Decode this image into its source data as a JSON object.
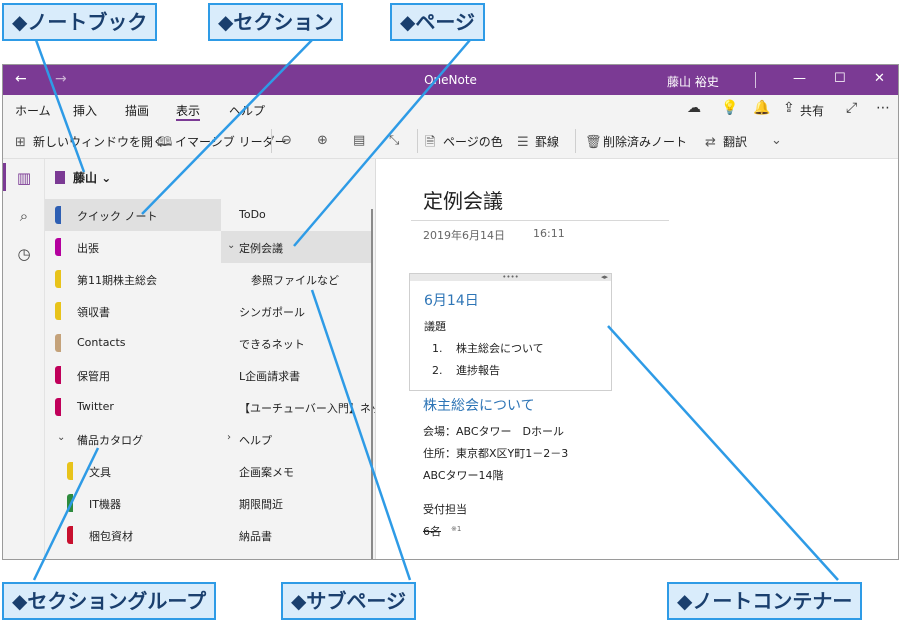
{
  "callouts": {
    "notebook": "◆ノートブック",
    "section": "◆セクション",
    "page": "◆ページ",
    "section_group": "◆セクショングループ",
    "subpage": "◆サブページ",
    "note_container": "◆ノートコンテナー"
  },
  "titlebar": {
    "back": "←",
    "forward": "→",
    "title": "OneNote",
    "user": "藤山 裕史",
    "minimize": "—",
    "maximize": "☐",
    "close": "✕"
  },
  "menu": {
    "tabs": [
      "ホーム",
      "挿入",
      "描画",
      "表示",
      "ヘルプ"
    ],
    "share": "共有",
    "more": "⋯"
  },
  "toolbar": {
    "new_window": "新しいウィンドウを開く",
    "immersive_reader": "イマーシブ リーダー",
    "page_color": "ページの色",
    "rule_lines": "罫線",
    "deleted_notes": "削除済みノート",
    "translate": "翻訳"
  },
  "notebook": {
    "name": "藤山"
  },
  "sections": [
    {
      "label": "クイック ノート",
      "color": "#2e5fb3"
    },
    {
      "label": "出張",
      "color": "#b4009e"
    },
    {
      "label": "第11期株主総会",
      "color": "#e8c31a"
    },
    {
      "label": "領収書",
      "color": "#e8c31a"
    },
    {
      "label": "Contacts",
      "color": "#c4a27a"
    },
    {
      "label": "保管用",
      "color": "#c0005a"
    },
    {
      "label": "Twitter",
      "color": "#c0005a"
    },
    {
      "label": "備品カタログ",
      "color": ""
    },
    {
      "label": "文具",
      "color": "#e8c31a"
    },
    {
      "label": "IT機器",
      "color": "#2e8b3e"
    },
    {
      "label": "梱包資材",
      "color": "#c8102e"
    }
  ],
  "pages": [
    {
      "label": "ToDo"
    },
    {
      "label": "定例会議"
    },
    {
      "label": "参照ファイルなど"
    },
    {
      "label": "シンガポール"
    },
    {
      "label": "できるネット"
    },
    {
      "label": "L企画請求書"
    },
    {
      "label": "【ユーチューバー入門】ネッ..."
    },
    {
      "label": "ヘルプ"
    },
    {
      "label": "企画案メモ"
    },
    {
      "label": "期限間近"
    },
    {
      "label": "納品書"
    }
  ],
  "canvas": {
    "title": "定例会議",
    "date": "2019年6月14日",
    "time": "16:11",
    "container": {
      "heading": "6月14日",
      "subheading": "議題",
      "items": [
        {
          "num": "1.",
          "text": "株主総会について"
        },
        {
          "num": "2.",
          "text": "進捗報告"
        }
      ]
    },
    "heading2": "株主総会について",
    "lines": [
      "会場：ABCタワー　Dホール",
      "住所：東京都X区Y町1－2－3",
      "ABCタワー14階"
    ],
    "reception": "受付担当",
    "count": "6名",
    "count_note": "※1"
  }
}
